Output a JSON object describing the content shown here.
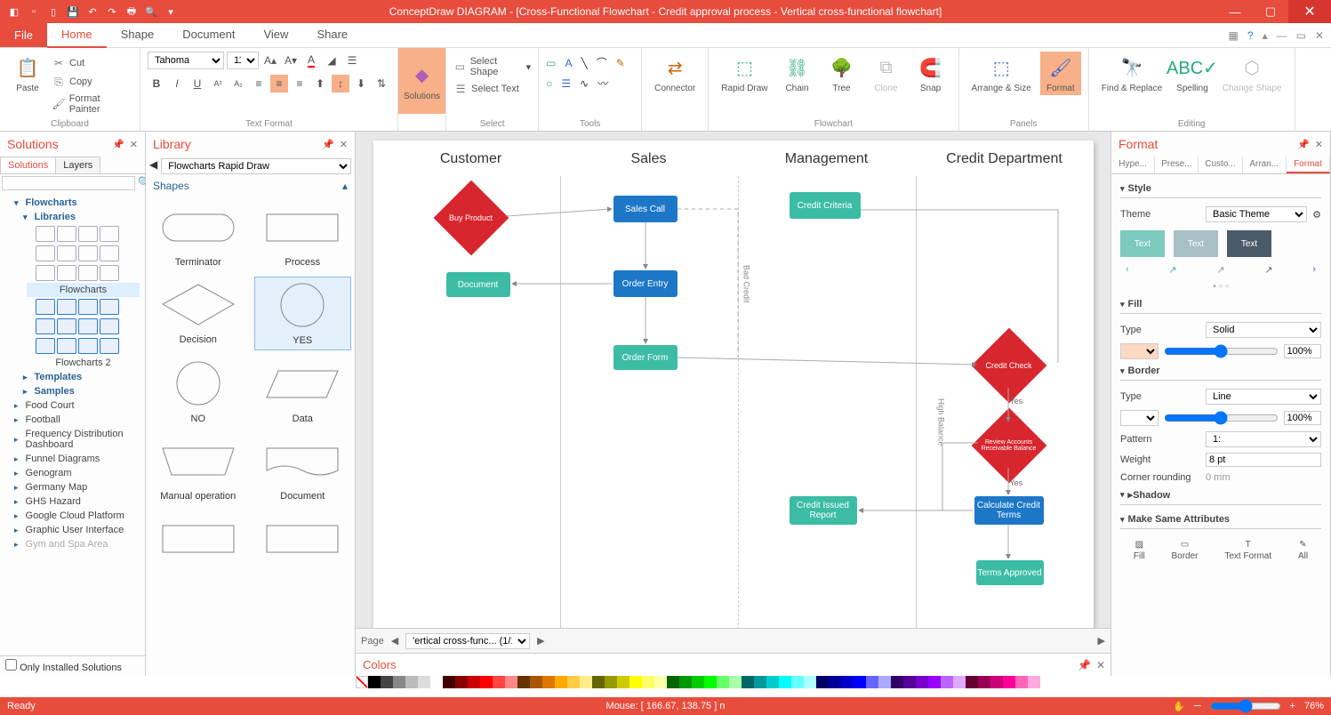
{
  "app": {
    "title": "ConceptDraw DIAGRAM - [Cross-Functional Flowchart - Credit approval process - Vertical cross-functional flowchart]"
  },
  "menu": {
    "file": "File",
    "tabs": [
      "Home",
      "Shape",
      "Document",
      "View",
      "Share"
    ],
    "active": "Home"
  },
  "ribbon": {
    "clipboard": {
      "paste": "Paste",
      "cut": "Cut",
      "copy": "Copy",
      "fp": "Format Painter",
      "label": "Clipboard"
    },
    "textfmt": {
      "font": "Tahoma",
      "size": "11",
      "label": "Text Format"
    },
    "solutions": {
      "btn": "Solutions"
    },
    "select": {
      "shape": "Select Shape",
      "text": "Select Text",
      "label": "Select"
    },
    "tools": {
      "label": "Tools"
    },
    "connector": "Connector",
    "flowchart": {
      "rapid": "Rapid Draw",
      "chain": "Chain",
      "tree": "Tree",
      "clone": "Clone",
      "snap": "Snap",
      "label": "Flowchart"
    },
    "panels": {
      "arrange": "Arrange & Size",
      "format": "Format",
      "label": "Panels"
    },
    "editing": {
      "find": "Find & Replace",
      "spell": "Spelling",
      "change": "Change Shape",
      "label": "Editing"
    }
  },
  "solutions": {
    "title": "Solutions",
    "tabs": [
      "Solutions",
      "Layers"
    ],
    "tree": {
      "flowcharts": "Flowcharts",
      "libraries": "Libraries",
      "flowcharts_lib": "Flowcharts",
      "flowcharts2": "Flowcharts 2",
      "templates": "Templates",
      "samples": "Samples"
    },
    "items": [
      "Food Court",
      "Football",
      "Frequency Distribution Dashboard",
      "Funnel Diagrams",
      "Genogram",
      "Germany Map",
      "GHS Hazard",
      "Google Cloud Platform",
      "Graphic User Interface",
      "Gym and Spa Area"
    ],
    "only": "Only Installed Solutions"
  },
  "library": {
    "title": "Library",
    "combo": "Flowcharts Rapid Draw",
    "shapes": "Shapes",
    "items": [
      "Terminator",
      "Process",
      "Decision",
      "YES",
      "NO",
      "Data",
      "Manual operation",
      "Document"
    ]
  },
  "canvas": {
    "lanes": [
      "Customer",
      "Sales",
      "Management",
      "Credit Department"
    ],
    "shapes": {
      "buy": "Buy Product",
      "salescall": "Sales Call",
      "criteria": "Credit Criteria",
      "document": "Document",
      "orderentry": "Order Entry",
      "orderform": "Order Form",
      "creditcheck": "Credit Check",
      "review": "Review Accounts Receivable Balance",
      "calc": "Calculate Credit Terms",
      "issued": "Credit Issued Report",
      "approved": "Terms Approved",
      "yes1": "Yes",
      "yes2": "Yes",
      "bad": "Bad Credit",
      "high": "High Balance"
    },
    "page": "Page",
    "pagetab": "'ertical cross-func... (1/1"
  },
  "colors": {
    "title": "Colors"
  },
  "format": {
    "title": "Format",
    "tabs": [
      "Hype...",
      "Prese...",
      "Custo...",
      "Arran...",
      "Format"
    ],
    "style": "Style",
    "theme": "Theme",
    "themeval": "Basic Theme",
    "text": "Text",
    "fill": "Fill",
    "type": "Type",
    "solid": "Solid",
    "pct": "100%",
    "border": "Border",
    "line": "Line",
    "pattern": "Pattern",
    "patval": "1:",
    "weight": "Weight",
    "weightval": "8 pt",
    "corner": "Corner rounding",
    "cornerval": "0 mm",
    "shadow": "Shadow",
    "same": "Make Same Attributes",
    "attrs": [
      "Fill",
      "Border",
      "Text Format",
      "All"
    ]
  },
  "status": {
    "ready": "Ready",
    "mouse": "Mouse: [ 166.67, 138.75 ] n",
    "zoom": "76%"
  }
}
